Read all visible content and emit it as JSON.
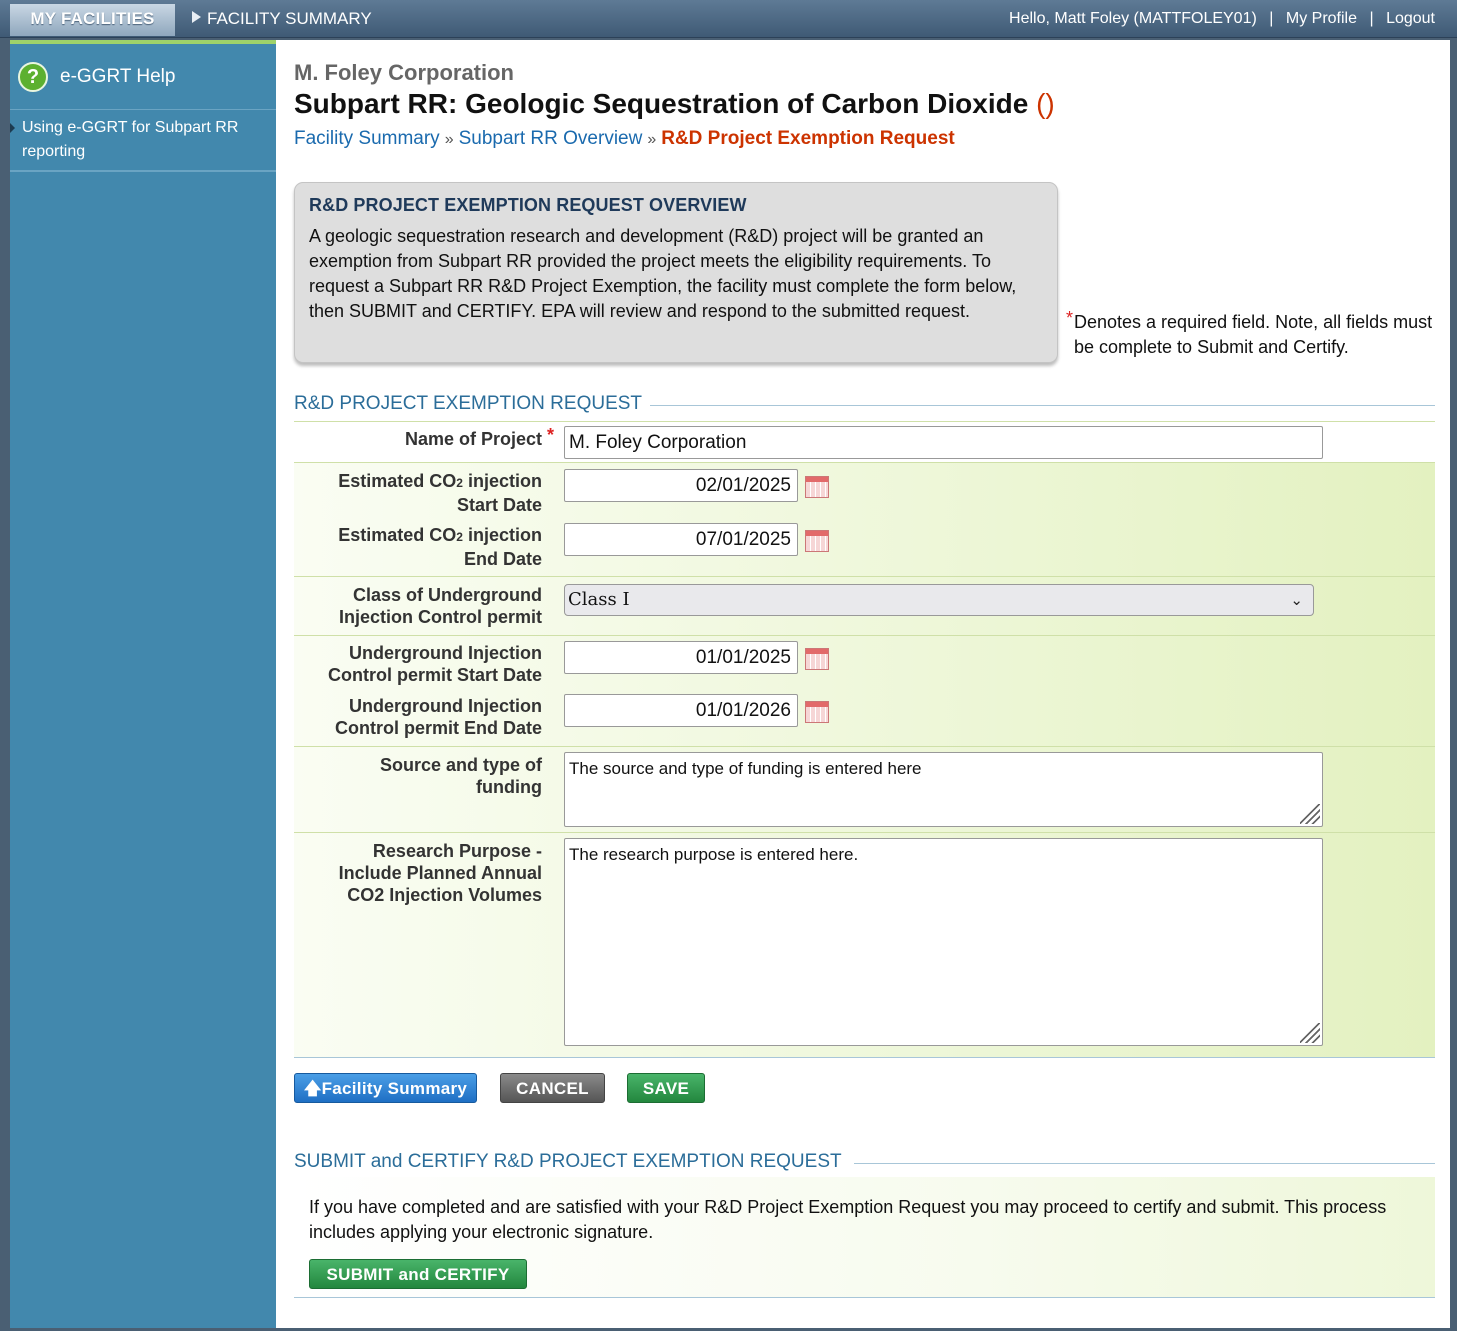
{
  "topbar": {
    "my_facilities": "MY FACILITIES",
    "facility_summary": "FACILITY SUMMARY",
    "greeting": "Hello, Matt Foley (MATTFOLEY01)",
    "my_profile": "My Profile",
    "logout": "Logout",
    "separator": "|"
  },
  "sidebar": {
    "title": "e-GGRT Help",
    "help_glyph": "?",
    "links": [
      "Using e-GGRT for Subpart RR reporting"
    ]
  },
  "header": {
    "company": "M. Foley Corporation",
    "title": "Subpart RR: Geologic Sequestration of Carbon Dioxide",
    "title_suffix": "()",
    "breadcrumb": {
      "items": [
        "Facility Summary",
        "Subpart RR Overview"
      ],
      "separator": "»",
      "current": "R&D Project Exemption Request"
    }
  },
  "overview": {
    "heading": "R&D PROJECT EXEMPTION REQUEST OVERVIEW",
    "text": "A geologic sequestration research and development (R&D) project will be granted an exemption from Subpart RR provided the project meets the eligibility requirements. To request a Subpart RR R&D Project Exemption, the facility must complete the form below, then SUBMIT and CERTIFY. EPA will review and respond to the submitted request."
  },
  "required_note": {
    "star": "*",
    "text": "Denotes a required field. Note, all fields must be complete to Submit and Certify."
  },
  "form": {
    "section_title": "R&D PROJECT EXEMPTION REQUEST",
    "required_star": "*",
    "name_of_project": {
      "label": "Name of Project",
      "value": "M. Foley Corporation"
    },
    "co2_start": {
      "label_line1": "Estimated CO",
      "label_sub": "2",
      "label_line1_rest": " injection",
      "label_line2": "Start Date",
      "value": "02/01/2025"
    },
    "co2_end": {
      "label_line1": "Estimated CO",
      "label_sub": "2",
      "label_line1_rest": " injection",
      "label_line2": "End Date",
      "value": "07/01/2025"
    },
    "uic_class": {
      "label_line1": "Class of Underground",
      "label_line2": "Injection Control permit",
      "value": "Class I"
    },
    "uic_start": {
      "label_line1": "Underground Injection",
      "label_line2": "Control permit Start Date",
      "value": "01/01/2025"
    },
    "uic_end": {
      "label_line1": "Underground Injection",
      "label_line2": "Control permit End Date",
      "value": "01/01/2026"
    },
    "funding": {
      "label_line1": "Source and type of",
      "label_line2": "funding",
      "value": "The source and type of funding is entered here"
    },
    "purpose": {
      "label_line1": "Research Purpose -",
      "label_line2": "Include Planned Annual",
      "label_line3": "CO2 Injection Volumes",
      "value": "The research purpose is entered here."
    }
  },
  "buttons": {
    "facility_summary": "Facility Summary",
    "cancel": "CANCEL",
    "save": "SAVE"
  },
  "certify": {
    "section_title": "SUBMIT and CERTIFY R&D PROJECT EXEMPTION REQUEST",
    "text": "If you have completed and are satisfied with your R&D Project Exemption Request you may proceed to certify and submit. This process includes applying your electronic signature.",
    "button": "SUBMIT and CERTIFY"
  },
  "icons": {
    "calendar": "calendar-icon",
    "help": "help-icon",
    "arrow_up": "arrow-up-icon",
    "chevron": "chevron-down-icon"
  },
  "colors": {
    "sidebar": "#4288ad",
    "accent_red": "#cc3300",
    "link_blue": "#1a6aae",
    "section_blue": "#2b6d99",
    "button_green": "#23873e",
    "button_blue": "#1f6fc4"
  }
}
